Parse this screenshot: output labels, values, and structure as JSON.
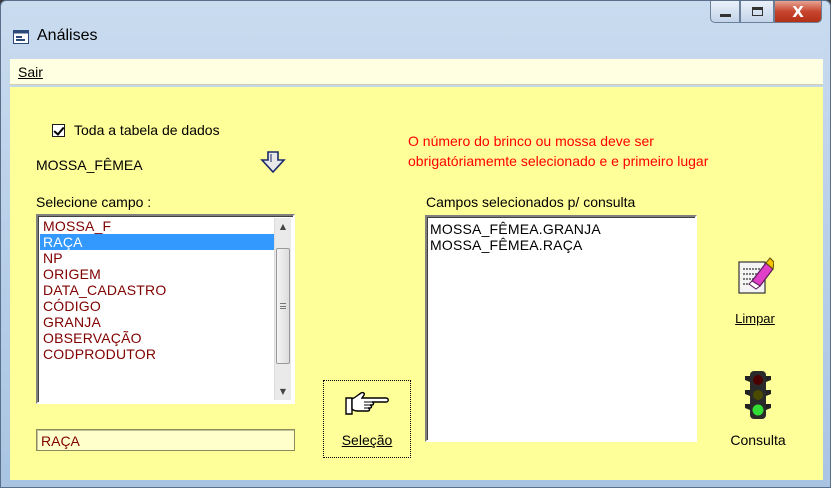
{
  "window": {
    "title": "Análises",
    "controls": [
      "minimize",
      "maximize",
      "close"
    ],
    "close_glyph": "X"
  },
  "menu": {
    "items": [
      {
        "label": "Sair"
      }
    ]
  },
  "form": {
    "whole_table_checkbox": {
      "label": "Toda a tabela de dados",
      "checked": true
    },
    "table_name": "MOSSA_FÊMEA",
    "select_field_label": "Selecione campo :",
    "fields": [
      {
        "label": "MOSSA_F",
        "selected": false
      },
      {
        "label": "RAÇA",
        "selected": true
      },
      {
        "label": "NP",
        "selected": false
      },
      {
        "label": "ORIGEM",
        "selected": false
      },
      {
        "label": "DATA_CADASTRO",
        "selected": false
      },
      {
        "label": "CÓDIGO",
        "selected": false
      },
      {
        "label": "GRANJA",
        "selected": false
      },
      {
        "label": "OBSERVAÇÃO",
        "selected": false
      },
      {
        "label": "CODPRODUTOR",
        "selected": false
      }
    ],
    "current_field_value": "RAÇA",
    "selection_button_label": "Seleção",
    "warning_line1": "O número do brinco ou mossa deve ser",
    "warning_line2": "obrigatóriamemte selecionado e e primeiro lugar",
    "selected_fields_label": "Campos selecionados p/ consulta",
    "selected_fields": [
      "MOSSA_FÊMEA.GRANJA",
      "MOSSA_FÊMEA.RAÇA"
    ],
    "clear_button_label": "Limpar",
    "query_button_label": "Consulta"
  },
  "colors": {
    "client_bg": "#ffff99",
    "menu_bg": "#ffffe1",
    "list_text": "#800000",
    "list_selection": "#3399ff",
    "warning_text": "#ff0000"
  },
  "icons": {
    "title": "form-icon",
    "table_arrow": "down-arrow-icon",
    "selection": "pointing-hand-icon",
    "clear": "eraser-document-icon",
    "query": "traffic-light-icon"
  }
}
